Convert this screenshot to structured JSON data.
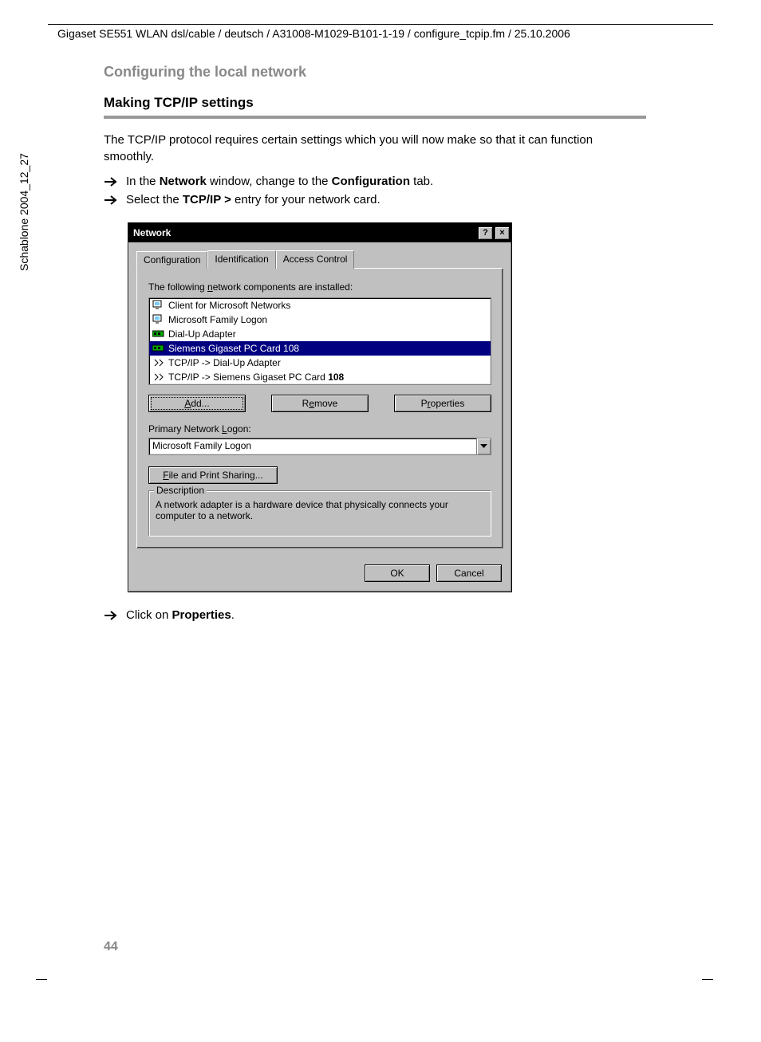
{
  "header": "Gigaset SE551 WLAN dsl/cable / deutsch / A31008-M1029-B101-1-19 / configure_tcpip.fm / 25.10.2006",
  "side_label": "Schablone 2004_12_27",
  "section_title": "Configuring the local network",
  "subsection_title": "Making TCP/IP settings",
  "intro": "The TCP/IP protocol requires certain settings which you will now make so that it can function smoothly.",
  "bullet1_pre": "In the ",
  "bullet1_b1": "Network",
  "bullet1_mid": " window, change to the ",
  "bullet1_b2": "Configuration",
  "bullet1_post": " tab.",
  "bullet2_pre": "Select the ",
  "bullet2_b1": "TCP/IP >",
  "bullet2_post": " entry for your network card.",
  "bullet3_pre": "Click on ",
  "bullet3_b1": "Properties",
  "bullet3_post": ".",
  "dialog": {
    "title": "Network",
    "help_glyph": "?",
    "close_glyph": "×",
    "tabs": [
      "Configuration",
      "Identification",
      "Access Control"
    ],
    "list_label_pre": "The following ",
    "list_label_u": "n",
    "list_label_post": "etwork components are installed:",
    "items": [
      {
        "text": "Client for Microsoft Networks",
        "selected": false,
        "icon": "client"
      },
      {
        "text": "Microsoft Family Logon",
        "selected": false,
        "icon": "client"
      },
      {
        "text": "Dial-Up Adapter",
        "selected": false,
        "icon": "adapter"
      },
      {
        "text": "Siemens Gigaset PC Card 108",
        "selected": true,
        "icon": "adapter"
      },
      {
        "text": "TCP/IP -> Dial-Up Adapter",
        "selected": false,
        "icon": "protocol"
      },
      {
        "text_pre": "TCP/IP -> Siemens Gigaset PC Card ",
        "text_b": "108",
        "selected": false,
        "icon": "protocol"
      }
    ],
    "btn_add_u": "A",
    "btn_add_post": "dd...",
    "btn_remove_pre": "R",
    "btn_remove_u": "e",
    "btn_remove_post": "move",
    "btn_props_pre": "P",
    "btn_props_u": "r",
    "btn_props_post": "operties",
    "primary_label_pre": "Primary Network ",
    "primary_label_u": "L",
    "primary_label_post": "ogon:",
    "primary_value": "Microsoft Family Logon",
    "fps_u": "F",
    "fps_post": "ile and Print Sharing...",
    "group_legend": "Description",
    "group_text": "A network adapter is a hardware device that physically connects your computer to a network.",
    "ok": "OK",
    "cancel": "Cancel"
  },
  "page_number": "44"
}
